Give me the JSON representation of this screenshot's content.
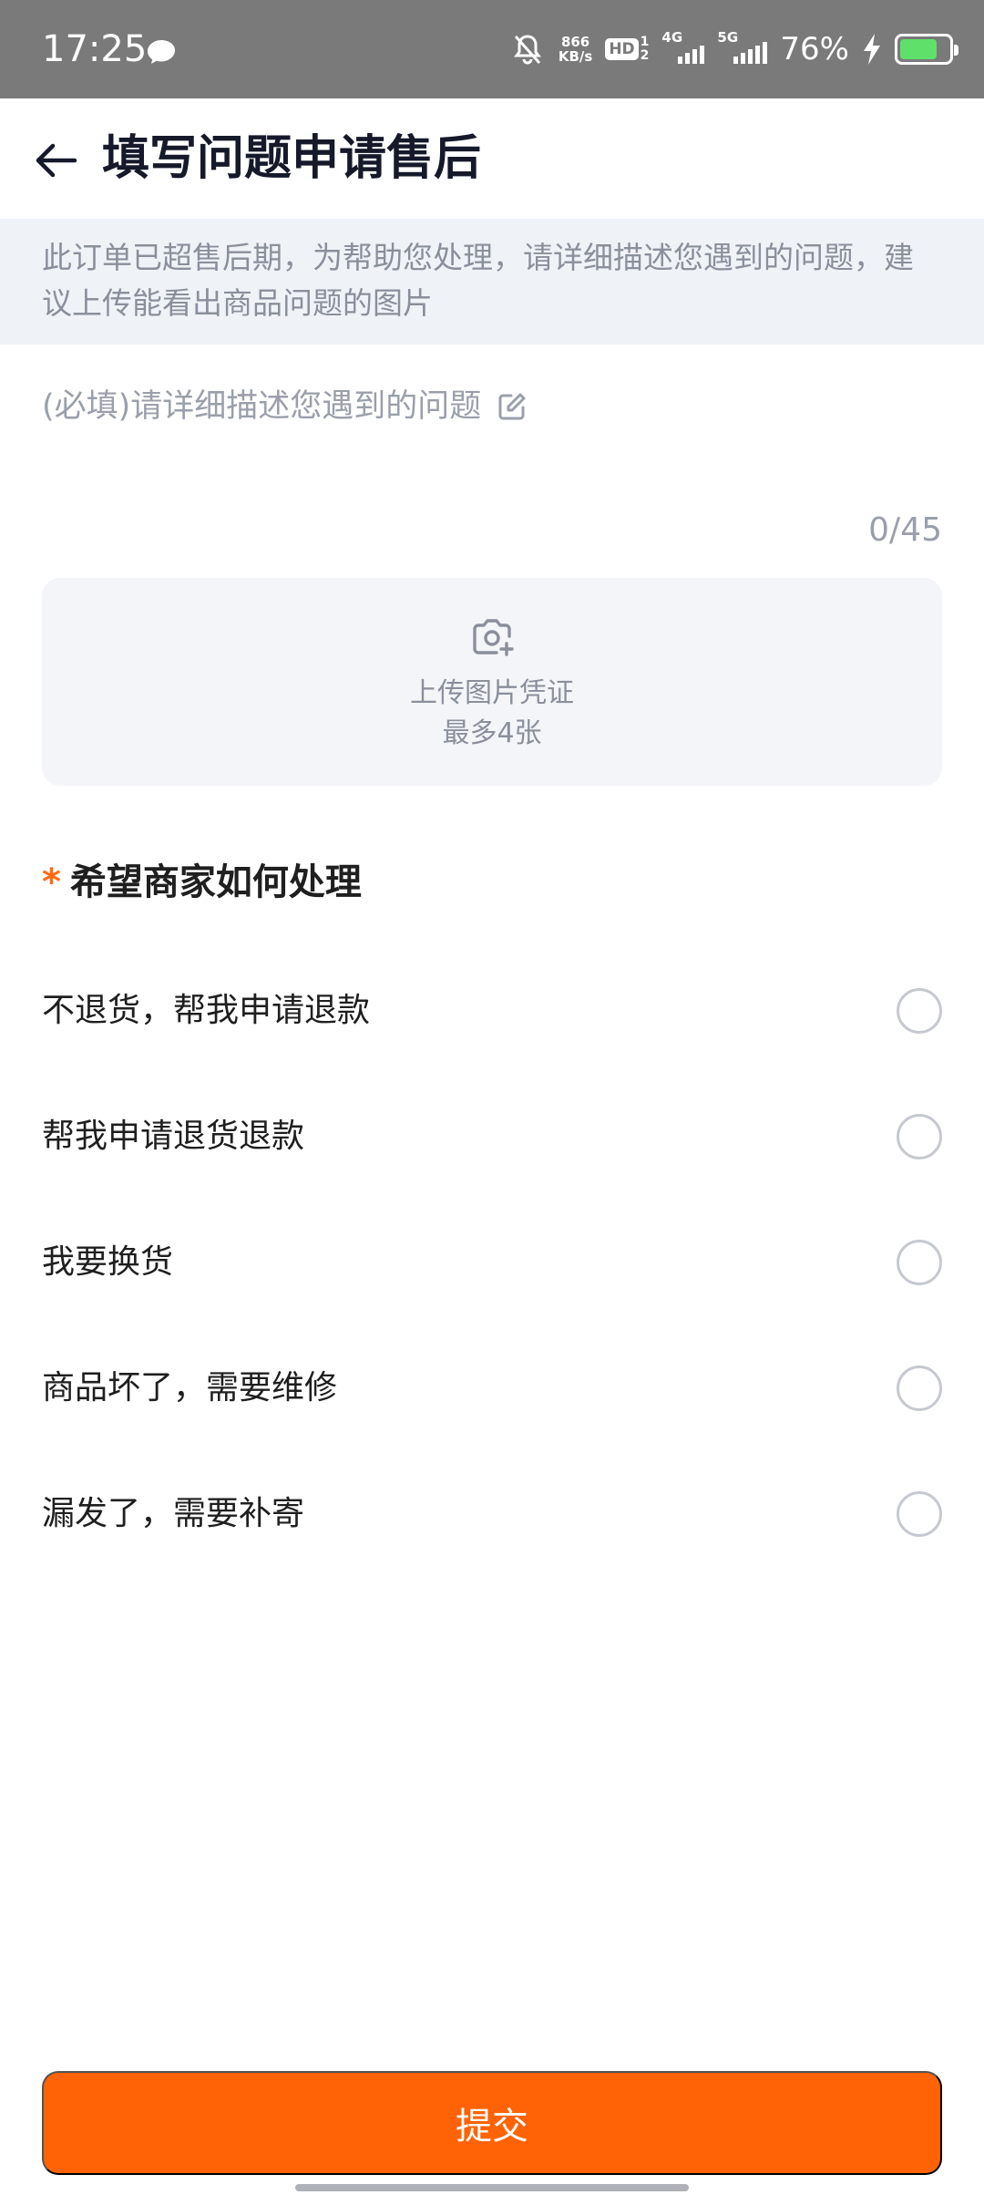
{
  "status_bar": {
    "time": "17:25",
    "net_speed_value": "866",
    "net_speed_unit": "KB/s",
    "hd_label": "HD",
    "hd_sub_1": "1",
    "hd_sub_2": "2",
    "signal1_label": "4G",
    "signal2_label": "5G",
    "battery_pct": "76%",
    "battery_level": 0.76,
    "battery_color": "#5ee06b",
    "icons": [
      "message-bubble-icon",
      "bell-off-icon",
      "hd-voice-icon",
      "signal-icon",
      "charging-bolt-icon",
      "battery-icon"
    ]
  },
  "header": {
    "title": "填写问题申请售后",
    "back_icon": "arrow-left-icon"
  },
  "notice": {
    "text": "此订单已超售后期，为帮助您处理，请详细描述您遇到的问题，建议上传能看出商品问题的图片"
  },
  "description": {
    "placeholder": "(必填)请详细描述您遇到的问题",
    "value": "",
    "char_count": "0/45",
    "edit_icon": "pencil-square-icon"
  },
  "upload": {
    "icon": "camera-plus-icon",
    "label": "上传图片凭证",
    "limit": "最多4张"
  },
  "handling": {
    "required_mark": "*",
    "title": "希望商家如何处理",
    "options": [
      {
        "label": "不退货，帮我申请退款",
        "selected": false
      },
      {
        "label": "帮我申请退货退款",
        "selected": false
      },
      {
        "label": "我要换货",
        "selected": false
      },
      {
        "label": "商品坏了，需要维修",
        "selected": false
      },
      {
        "label": "漏发了，需要补寄",
        "selected": false
      }
    ]
  },
  "submit": {
    "label": "提交",
    "color": "#ff6305"
  },
  "colors": {
    "accent": "#ff6305",
    "required_star": "#ff6a13",
    "notice_bg": "#eff3f8",
    "upload_bg": "#f3f5f9",
    "status_bar_bg": "#7a7a7a"
  }
}
